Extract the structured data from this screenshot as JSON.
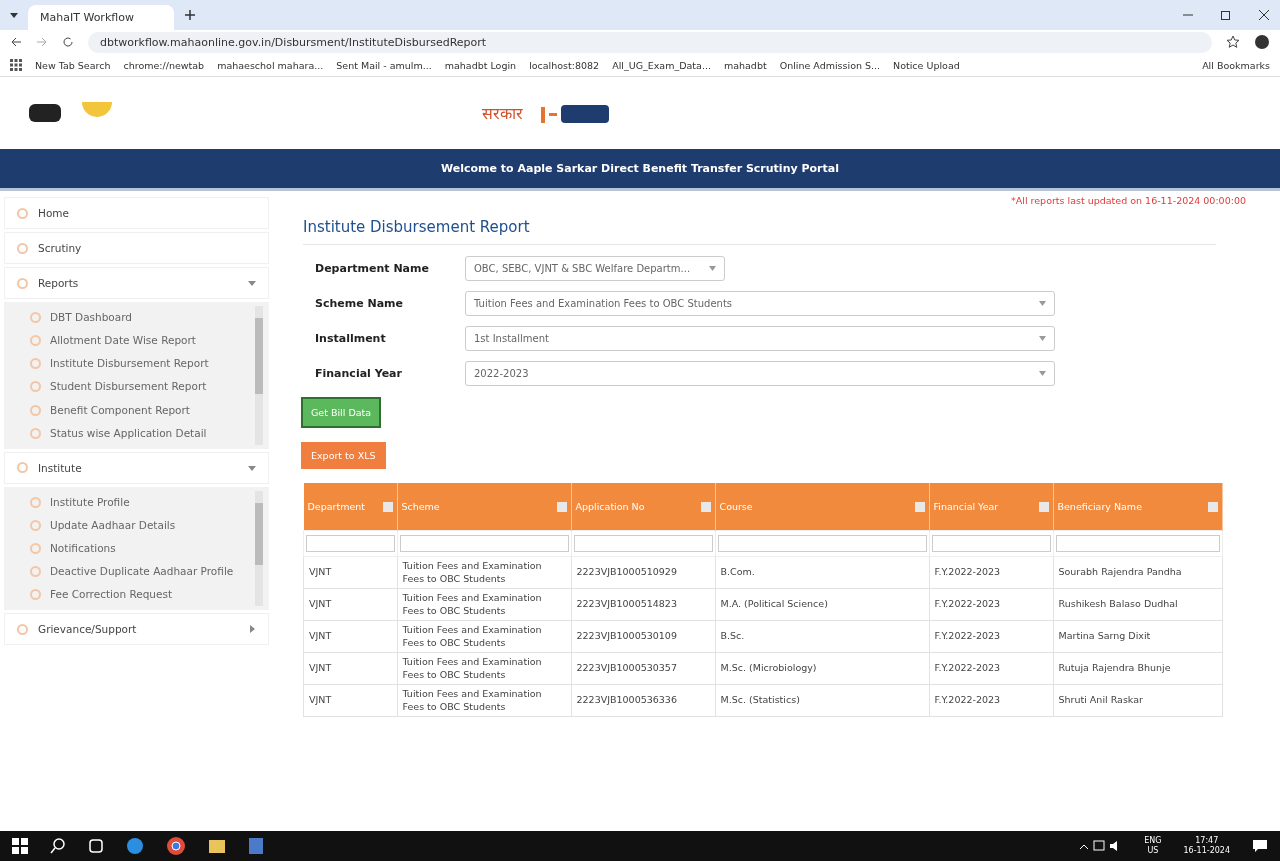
{
  "browser": {
    "tabs": [
      {
        "title": "MahaIT Workflow",
        "selected": true
      }
    ],
    "address": "dbtworkflow.mahaonline.gov.in/Disbursment/InstituteDisbursedReport",
    "bookmarks": [
      "New Tab Search",
      "chrome://newtab",
      "mahaeschol mahara...",
      "Sent Mail - amulm...",
      "mahadbt Login",
      "localhost:8082",
      "All_UG_Exam_Data...",
      "mahadbt",
      "Online Admission S...",
      "Notice Upload"
    ],
    "all_bookmarks": "All Bookmarks"
  },
  "header": {
    "logo_text": "सरकार",
    "banner": "Welcome to Aaple Sarkar Direct Benefit Transfer Scrutiny Portal"
  },
  "sidebar": [
    {
      "kind": "link",
      "label": "Home"
    },
    {
      "kind": "link",
      "label": "Scrutiny"
    },
    {
      "kind": "group",
      "label": "Reports",
      "expanded": true,
      "children": [
        "DBT Dashboard",
        "Allotment Date Wise Report",
        "Institute Disbursement Report",
        "Student Disbursement Report",
        "Benefit Component Report",
        "Status wise Application Detail"
      ]
    },
    {
      "kind": "group",
      "label": "Institute",
      "expanded": true,
      "children": [
        "Institute Profile",
        "Update Aadhaar Details",
        "Notifications",
        "Deactive Duplicate Aadhaar Profile",
        "Fee Correction Request"
      ]
    },
    {
      "kind": "group",
      "label": "Grievance/Support",
      "expanded": false
    }
  ],
  "notice": "*All reports last updated on 16-11-2024 00:00:00",
  "title": "Institute Disbursement Report",
  "form": [
    {
      "label": "Department Name",
      "value": "OBC, SEBC, VJNT & SBC Welfare Departm...",
      "wide": false
    },
    {
      "label": "Scheme Name",
      "value": "Tuition Fees and Examination Fees to OBC Students",
      "wide": true
    },
    {
      "label": "Installment",
      "value": "1st Installment",
      "wide": true
    },
    {
      "label": "Financial Year",
      "value": "2022-2023",
      "wide": true
    }
  ],
  "get_button": "Get Bill Data",
  "export_button": "Export to XLS",
  "table": {
    "columns": [
      "Department",
      "Scheme",
      "Application No",
      "Course",
      "Financial Year",
      "Beneficiary Name"
    ],
    "rows": [
      [
        "VJNT",
        "Tuition Fees and Examination Fees to OBC Students",
        "2223VJB1000510929",
        "B.Com.",
        "F.Y.2022-2023",
        "Sourabh Rajendra Pandha"
      ],
      [
        "VJNT",
        "Tuition Fees and Examination Fees to OBC Students",
        "2223VJB1000514823",
        "M.A. (Political Science)",
        "F.Y.2022-2023",
        "Rushikesh Balaso Dudhal"
      ],
      [
        "VJNT",
        "Tuition Fees and Examination Fees to OBC Students",
        "2223VJB1000530109",
        "B.Sc.",
        "F.Y.2022-2023",
        "Martina Sarng Dixit"
      ],
      [
        "VJNT",
        "Tuition Fees and Examination Fees to OBC Students",
        "2223VJB1000530357",
        "M.Sc. (Microbiology)",
        "F.Y.2022-2023",
        "Rutuja Rajendra Bhunje"
      ],
      [
        "VJNT",
        "Tuition Fees and Examination Fees to OBC Students",
        "2223VJB1000536336",
        "M.Sc. (Statistics)",
        "F.Y.2022-2023",
        "Shruti Anil Raskar"
      ]
    ]
  },
  "taskbar": {
    "lang": "ENG",
    "region": "US",
    "time": "17:47",
    "date": "16-11-2024"
  }
}
